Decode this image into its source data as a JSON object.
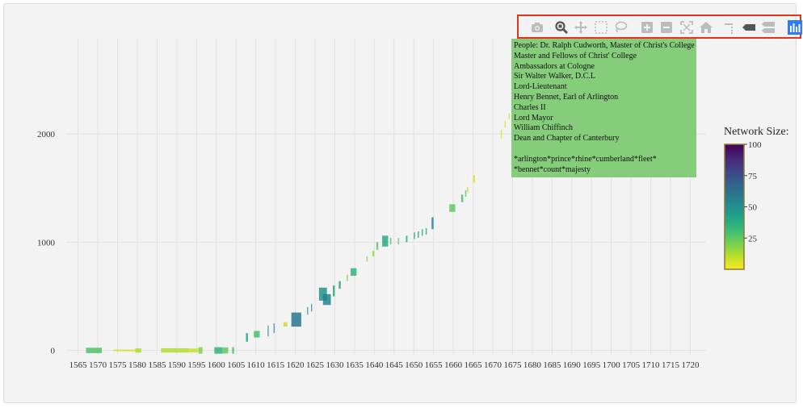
{
  "chart_data": {
    "type": "bar",
    "x_range": [
      1562,
      1724
    ],
    "y_range": [
      -40,
      2880
    ],
    "x_ticks": [
      1565,
      1570,
      1575,
      1580,
      1585,
      1590,
      1595,
      1600,
      1605,
      1610,
      1615,
      1620,
      1625,
      1630,
      1635,
      1640,
      1645,
      1650,
      1655,
      1660,
      1665,
      1670,
      1675,
      1680,
      1685,
      1690,
      1695,
      1700,
      1705,
      1710,
      1715,
      1720
    ],
    "y_ticks": [
      0,
      1000,
      2000
    ],
    "colorbar": {
      "title": "Network Size:",
      "min": 0,
      "max": 100,
      "ticks": [
        25,
        50,
        75,
        100
      ]
    },
    "segments": [
      {
        "x0": 1567.0,
        "x1": 1571.0,
        "y0": -25,
        "y1": 25,
        "v": 28
      },
      {
        "x0": 1574.0,
        "x1": 1580.0,
        "y0": -8,
        "y1": 8,
        "v": 6
      },
      {
        "x0": 1579.5,
        "x1": 1581.0,
        "y0": -20,
        "y1": 20,
        "v": 12
      },
      {
        "x0": 1586.0,
        "x1": 1593.0,
        "y0": -20,
        "y1": 20,
        "v": 12
      },
      {
        "x0": 1593.0,
        "x1": 1595.5,
        "y0": -18,
        "y1": 18,
        "v": 8
      },
      {
        "x0": 1595.5,
        "x1": 1596.5,
        "y0": -30,
        "y1": 30,
        "v": 20
      },
      {
        "x0": 1599.5,
        "x1": 1601.5,
        "y0": -30,
        "y1": 30,
        "v": 35
      },
      {
        "x0": 1601.5,
        "x1": 1603.0,
        "y0": -28,
        "y1": 28,
        "v": 25
      },
      {
        "x0": 1604.0,
        "x1": 1604.5,
        "y0": -30,
        "y1": 30,
        "v": 28
      },
      {
        "x0": 1607.5,
        "x1": 1608.0,
        "y0": 80,
        "y1": 160,
        "v": 42
      },
      {
        "x0": 1609.5,
        "x1": 1611.0,
        "y0": 120,
        "y1": 180,
        "v": 30
      },
      {
        "x0": 1613.0,
        "x1": 1613.2,
        "y0": 130,
        "y1": 230,
        "v": 55
      },
      {
        "x0": 1614.5,
        "x1": 1614.7,
        "y0": 160,
        "y1": 250,
        "v": 55
      },
      {
        "x0": 1617.0,
        "x1": 1618.0,
        "y0": 220,
        "y1": 260,
        "v": 8
      },
      {
        "x0": 1619.0,
        "x1": 1621.5,
        "y0": 220,
        "y1": 350,
        "v": 60
      },
      {
        "x0": 1623.0,
        "x1": 1623.2,
        "y0": 330,
        "y1": 400,
        "v": 55
      },
      {
        "x0": 1624.0,
        "x1": 1624.2,
        "y0": 360,
        "y1": 430,
        "v": 55
      },
      {
        "x0": 1626.0,
        "x1": 1628.0,
        "y0": 460,
        "y1": 580,
        "v": 48
      },
      {
        "x0": 1627.0,
        "x1": 1629.0,
        "y0": 420,
        "y1": 520,
        "v": 55
      },
      {
        "x0": 1629.5,
        "x1": 1630.0,
        "y0": 500,
        "y1": 600,
        "v": 40
      },
      {
        "x0": 1631.0,
        "x1": 1631.5,
        "y0": 570,
        "y1": 640,
        "v": 40
      },
      {
        "x0": 1633.0,
        "x1": 1633.3,
        "y0": 640,
        "y1": 700,
        "v": 20
      },
      {
        "x0": 1634.0,
        "x1": 1635.5,
        "y0": 690,
        "y1": 760,
        "v": 35
      },
      {
        "x0": 1638.0,
        "x1": 1638.3,
        "y0": 820,
        "y1": 870,
        "v": 15
      },
      {
        "x0": 1639.5,
        "x1": 1640.0,
        "y0": 870,
        "y1": 920,
        "v": 15
      },
      {
        "x0": 1640.5,
        "x1": 1641.0,
        "y0": 930,
        "y1": 1000,
        "v": 25
      },
      {
        "x0": 1642.0,
        "x1": 1643.5,
        "y0": 960,
        "y1": 1060,
        "v": 40
      },
      {
        "x0": 1644.0,
        "x1": 1644.3,
        "y0": 980,
        "y1": 1040,
        "v": 30
      },
      {
        "x0": 1646.0,
        "x1": 1646.2,
        "y0": 980,
        "y1": 1040,
        "v": 30
      },
      {
        "x0": 1648.0,
        "x1": 1648.4,
        "y0": 1000,
        "y1": 1060,
        "v": 40
      },
      {
        "x0": 1650.0,
        "x1": 1650.3,
        "y0": 1030,
        "y1": 1090,
        "v": 40
      },
      {
        "x0": 1651.0,
        "x1": 1651.3,
        "y0": 1040,
        "y1": 1100,
        "v": 40
      },
      {
        "x0": 1652.0,
        "x1": 1652.3,
        "y0": 1060,
        "y1": 1120,
        "v": 40
      },
      {
        "x0": 1653.0,
        "x1": 1653.3,
        "y0": 1070,
        "y1": 1130,
        "v": 40
      },
      {
        "x0": 1654.5,
        "x1": 1655.0,
        "y0": 1120,
        "y1": 1230,
        "v": 55
      },
      {
        "x0": 1659.0,
        "x1": 1660.5,
        "y0": 1280,
        "y1": 1350,
        "v": 25
      },
      {
        "x0": 1662.0,
        "x1": 1662.5,
        "y0": 1370,
        "y1": 1440,
        "v": 30
      },
      {
        "x0": 1663.0,
        "x1": 1663.3,
        "y0": 1420,
        "y1": 1480,
        "v": 25
      },
      {
        "x0": 1663.5,
        "x1": 1663.8,
        "y0": 1460,
        "y1": 1510,
        "v": 10
      },
      {
        "x0": 1665.0,
        "x1": 1665.5,
        "y0": 1550,
        "y1": 1620,
        "v": 5
      },
      {
        "x0": 1672.0,
        "x1": 1672.3,
        "y0": 1960,
        "y1": 2040,
        "v": 5
      },
      {
        "x0": 1673.0,
        "x1": 1673.3,
        "y0": 2060,
        "y1": 2120,
        "v": 5
      },
      {
        "x0": 1674.0,
        "x1": 1674.3,
        "y0": 2140,
        "y1": 2190,
        "v": 5
      },
      {
        "x0": 1675.0,
        "x1": 1675.6,
        "y0": 2240,
        "y1": 2320,
        "v": 25
      }
    ]
  },
  "hover": {
    "lines": [
      "People: Dr. Ralph Cudworth, Master of Christ's College",
      "Master and Fellows of Christ' College",
      "Ambassadors at Cologne",
      "Sir Walter Walker, D.C.L",
      "Lord-Lieutenant",
      "Henry Bennet, Earl of Arlington",
      "Charles II",
      "Lord Mayor",
      "William Chiffinch",
      "Dean and Chapter of Canterbury",
      "",
      "*arlington*prince*rhine*cumberland*fleet*",
      "*bennet*count*majesty"
    ]
  },
  "modebar": {
    "icons": [
      "camera-icon",
      "zoom-icon",
      "pan-icon",
      "box-select-icon",
      "lasso-icon",
      "zoom-in-icon",
      "zoom-out-icon",
      "autoscale-icon",
      "reset-axes-icon",
      "spike-lines-icon",
      "hover-closest-icon",
      "hover-compare-icon",
      "plotly-logo-icon"
    ],
    "active_color": "#2f7df6",
    "icon_color": "#bcbcbc",
    "highlight_border": "#e8331c"
  },
  "colors": {
    "background": "#f3f3f3",
    "grid": "#e2e2e2",
    "colorscale": [
      "#fde725",
      "#b5de2b",
      "#6ece58",
      "#35b779",
      "#1f9e89",
      "#26828e",
      "#31688e",
      "#3e4989",
      "#482878",
      "#440154"
    ]
  }
}
